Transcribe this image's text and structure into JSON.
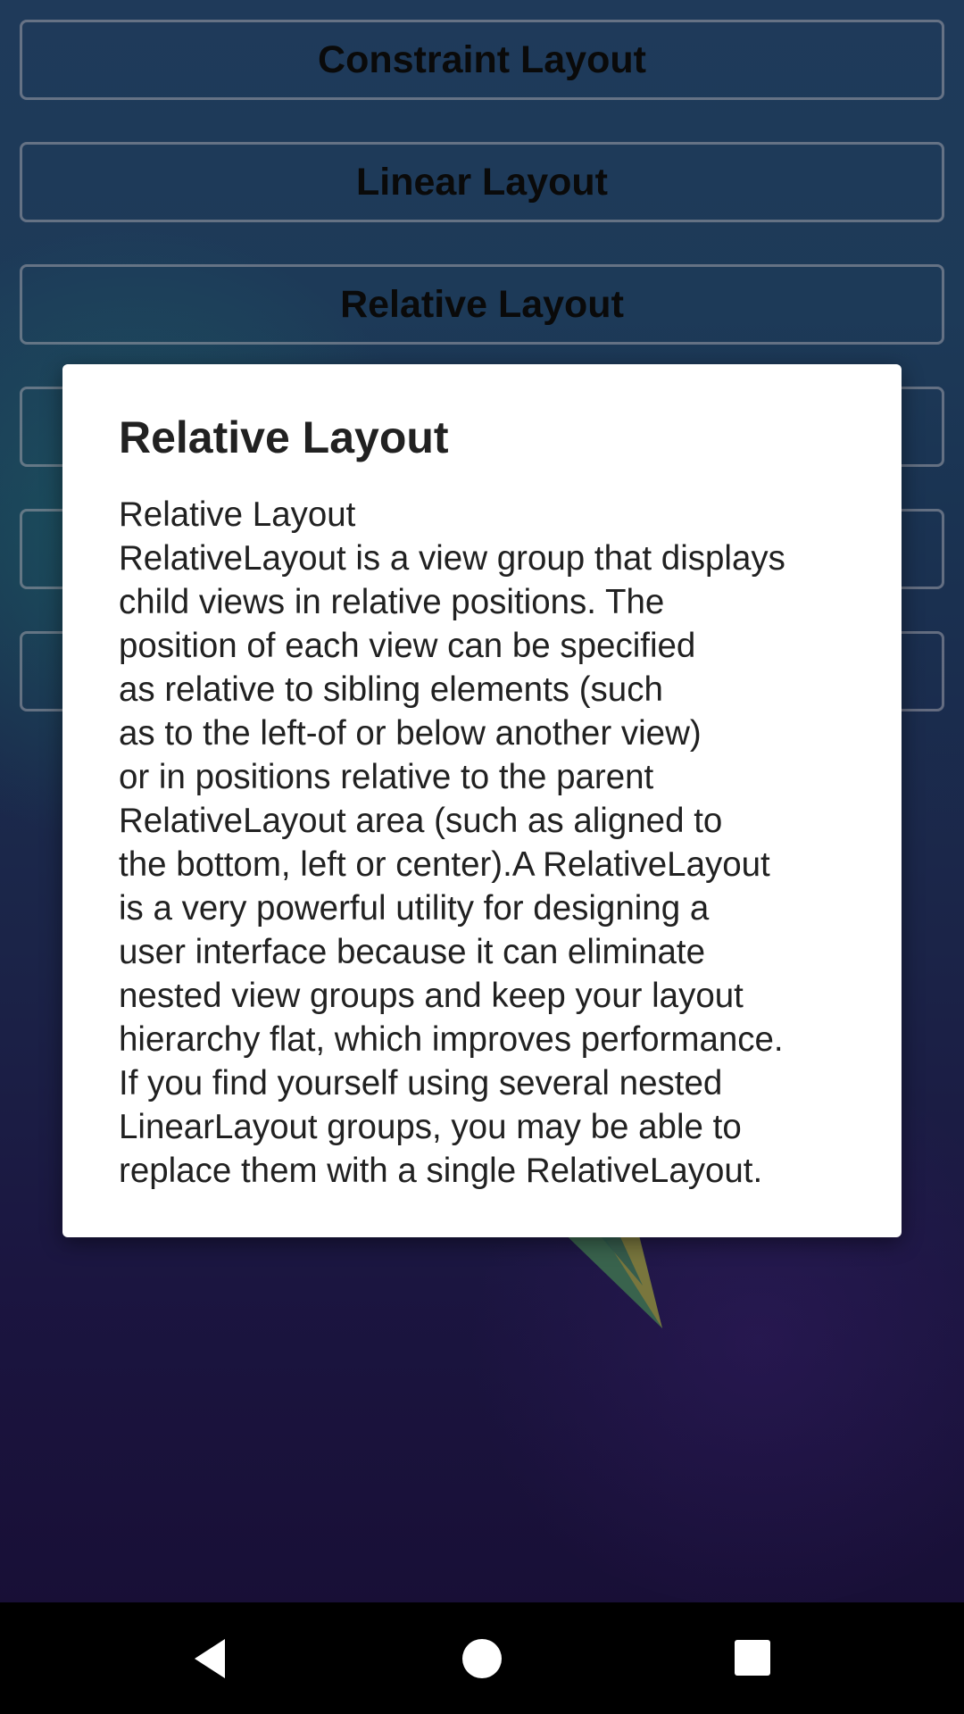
{
  "layout_buttons": [
    {
      "label": "Constraint Layout"
    },
    {
      "label": "Linear Layout"
    },
    {
      "label": "Relative Layout"
    },
    {
      "label": ""
    },
    {
      "label": ""
    },
    {
      "label": ""
    }
  ],
  "dialog": {
    "title": "Relative Layout",
    "body": "Relative Layout\nRelativeLayout is a view group that displays\nchild views in relative positions. The\nposition of each view can be specified\nas relative to sibling elements (such\nas to the left-of or below another view)\nor in positions relative to the parent\nRelativeLayout area (such as aligned to\nthe bottom, left or center).A RelativeLayout\nis a very powerful utility for designing a\nuser interface because it can eliminate\nnested view groups and keep your layout\nhierarchy flat, which improves performance.\nIf you find yourself using several nested\nLinearLayout groups, you may be able to\nreplace them with a single RelativeLayout."
  },
  "navbar": {
    "back_icon": "back-triangle-icon",
    "home_icon": "home-circle-icon",
    "recents_icon": "recents-square-icon",
    "color": "#000000"
  },
  "colors": {
    "dialog_bg": "#ffffff",
    "text": "#212121"
  }
}
